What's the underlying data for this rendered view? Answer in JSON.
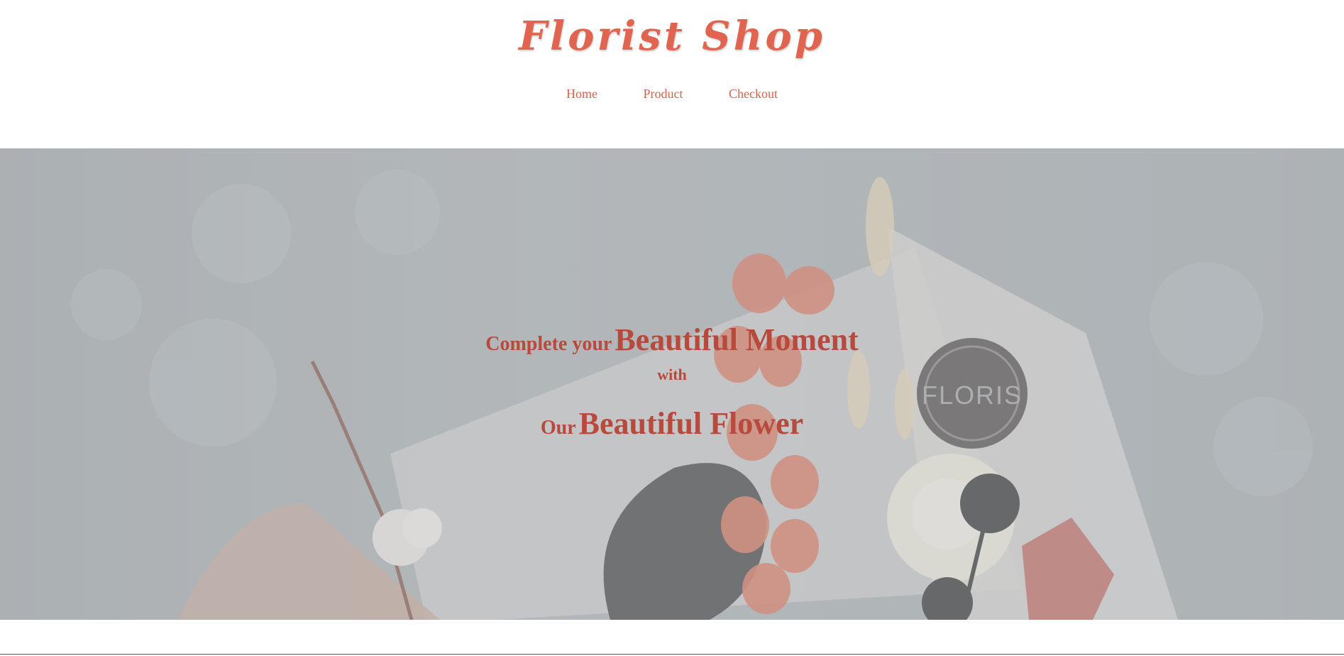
{
  "header": {
    "logo": "Florist Shop",
    "nav": [
      {
        "label": "Home"
      },
      {
        "label": "Product"
      },
      {
        "label": "Checkout"
      }
    ]
  },
  "hero": {
    "line1_small": "Complete your",
    "line1_big": "Beautiful Moment",
    "line2": "with",
    "line3_small": "Our",
    "line3_big": "Beautiful Flower",
    "badge_text": "FLORIS"
  },
  "colors": {
    "accent": "#d3634f",
    "hero_text": "#b8493d"
  }
}
